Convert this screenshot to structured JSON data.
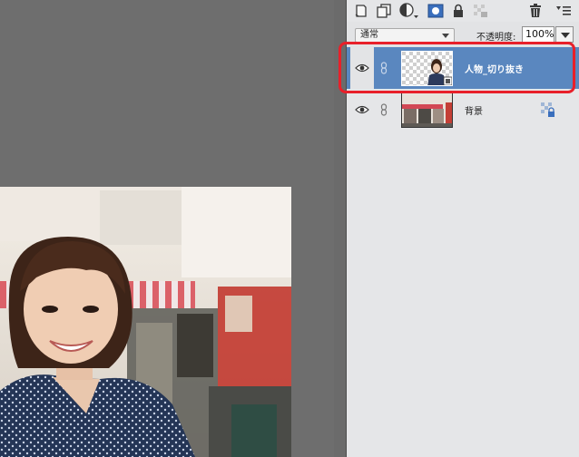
{
  "layers_panel": {
    "toolbar": {
      "icons": [
        "new-layer-icon",
        "duplicate-layer-icon",
        "adjustment-layer-icon",
        "layer-mask-icon",
        "lock-icon",
        "lock-transparency-icon",
        "trash-icon",
        "panel-menu-icon"
      ]
    },
    "blend_mode": "通常",
    "opacity_label": "不透明度:",
    "opacity_value": "100%",
    "layers": [
      {
        "name": "人物_切り抜き",
        "selected": true
      },
      {
        "name": "背景",
        "selected": false
      }
    ]
  },
  "colors": {
    "selected_row": "#5a87bf",
    "panel_bg": "#e5e6e8",
    "canvas_bg": "#6e6e6e",
    "highlight": "#e8202a"
  }
}
